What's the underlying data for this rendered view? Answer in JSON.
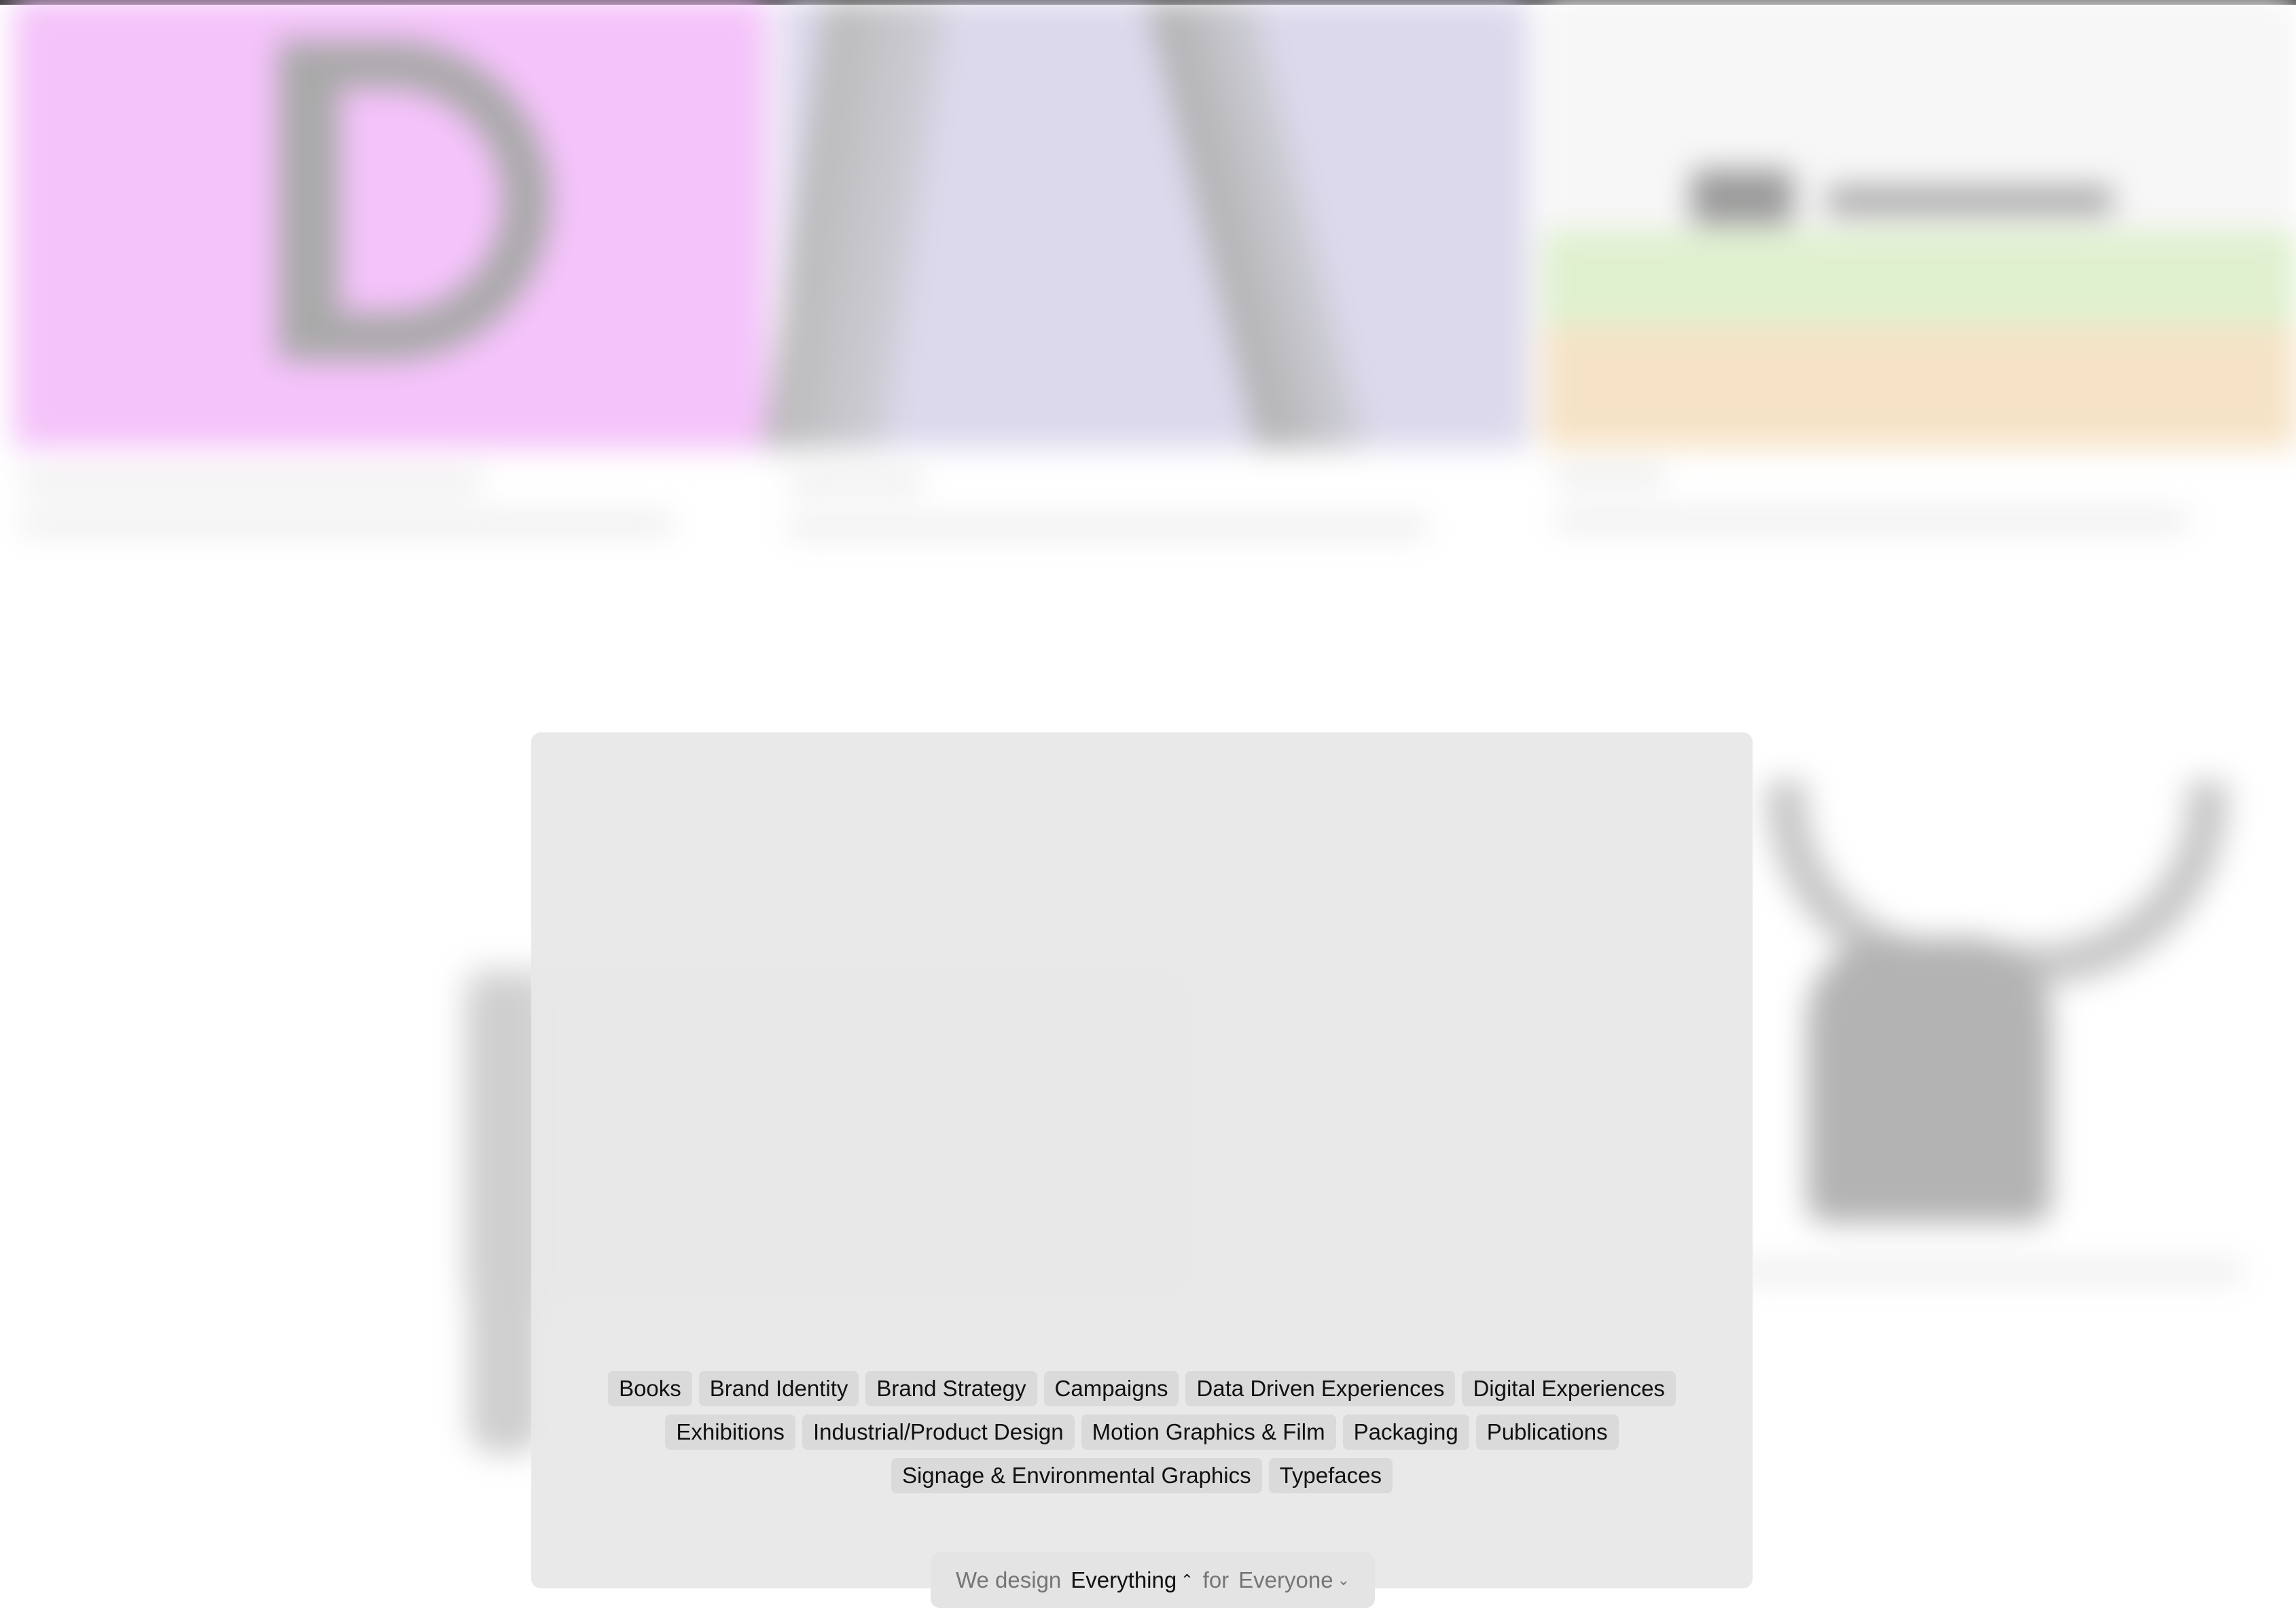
{
  "categories": [
    [
      "Books",
      "Brand Identity",
      "Brand Strategy",
      "Campaigns",
      "Data Driven Experiences",
      "Digital Experiences"
    ],
    [
      "Exhibitions",
      "Industrial/Product Design",
      "Motion Graphics & Film",
      "Packaging",
      "Publications"
    ],
    [
      "Signage & Environmental Graphics",
      "Typefaces"
    ]
  ],
  "selector": {
    "prefix": "We design",
    "what": "Everything",
    "what_icon": "chevron-up-icon",
    "connector": "for",
    "who": "Everyone",
    "who_icon": "chevron-down-icon"
  },
  "colors": {
    "tile_pink": "#f4c3fa",
    "tile_lavender": "#dcd9ec",
    "overlay": "#e8e8e8",
    "tag_bg": "#dadada",
    "muted_text": "#757575"
  }
}
